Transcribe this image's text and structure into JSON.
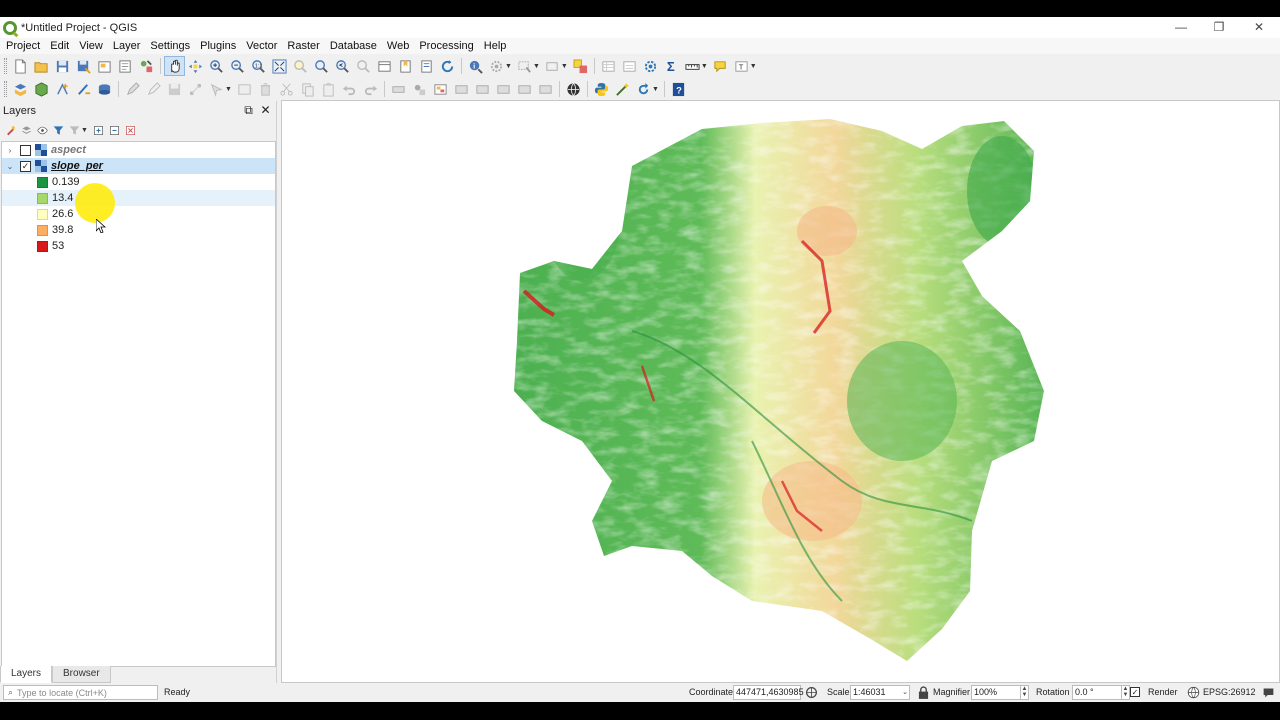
{
  "window": {
    "title": "*Untitled Project - QGIS",
    "min_glyph": "—",
    "restore_glyph": "❐",
    "close_glyph": "✕"
  },
  "menus": [
    "Project",
    "Edit",
    "View",
    "Layer",
    "Settings",
    "Plugins",
    "Vector",
    "Raster",
    "Database",
    "Web",
    "Processing",
    "Help"
  ],
  "layers_panel": {
    "title": "Layers",
    "float_glyph": "⧉",
    "close_glyph": "✕",
    "layers": [
      {
        "name": "aspect",
        "checked": false,
        "expanded": false,
        "expander": "›"
      },
      {
        "name": "slope_per",
        "checked": true,
        "expanded": true,
        "expander": "⌄",
        "check_glyph": "✓"
      }
    ],
    "legend": [
      {
        "label": "0.139",
        "color": "#1a9641"
      },
      {
        "label": "13.4",
        "color": "#a6d96a"
      },
      {
        "label": "26.6",
        "color": "#ffffc0"
      },
      {
        "label": "39.8",
        "color": "#fdae61"
      },
      {
        "label": "53",
        "color": "#d7191c"
      }
    ],
    "tabs": [
      "Layers",
      "Browser"
    ]
  },
  "statusbar": {
    "locator_placeholder": "Type to locate (Ctrl+K)",
    "status": "Ready",
    "coordinate_label": "Coordinate",
    "coordinate_value": "447471,4630985",
    "scale_label": "Scale",
    "scale_value": "1:46031",
    "magnifier_label": "Magnifier",
    "magnifier_value": "100%",
    "rotation_label": "Rotation",
    "rotation_value": "0.0 °",
    "render_label": "Render",
    "render_checked": true,
    "crs": "EPSG:26912"
  },
  "colors": {
    "accent": "#589632",
    "selection": "#cce4f7",
    "ramp": [
      "#1a9641",
      "#a6d96a",
      "#ffffc0",
      "#fdae61",
      "#d7191c"
    ]
  }
}
